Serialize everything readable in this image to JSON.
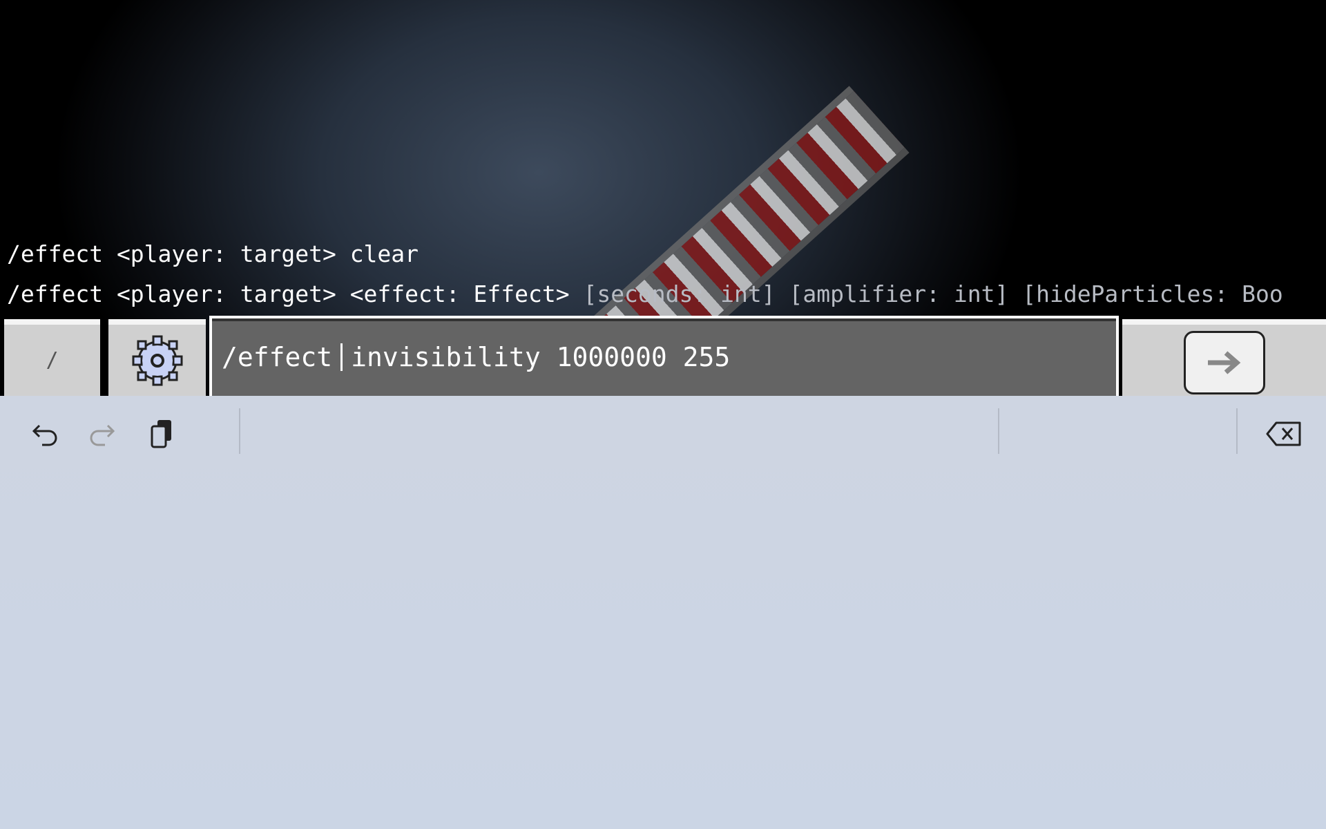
{
  "suggestions": [
    {
      "required": "/effect <player: target> clear",
      "optional": ""
    },
    {
      "required": "/effect <player: target> <effect: Effect> ",
      "optional": "[seconds: int] [amplifier: int] [hideParticles: Boo"
    }
  ],
  "command_bar": {
    "slash_label": "/",
    "input_before_cursor": "/effect",
    "input_after_cursor": "invisibility 1000000 255"
  },
  "keyboard_toolbar": {
    "icons": [
      "undo-icon",
      "redo-icon",
      "paste-icon",
      "backspace-icon"
    ]
  },
  "colors": {
    "input_bg": "#646464",
    "button_bg": "#d0d0d0",
    "keyboard_bg": "#cdd5e3",
    "gear": "#c8d2f5"
  }
}
